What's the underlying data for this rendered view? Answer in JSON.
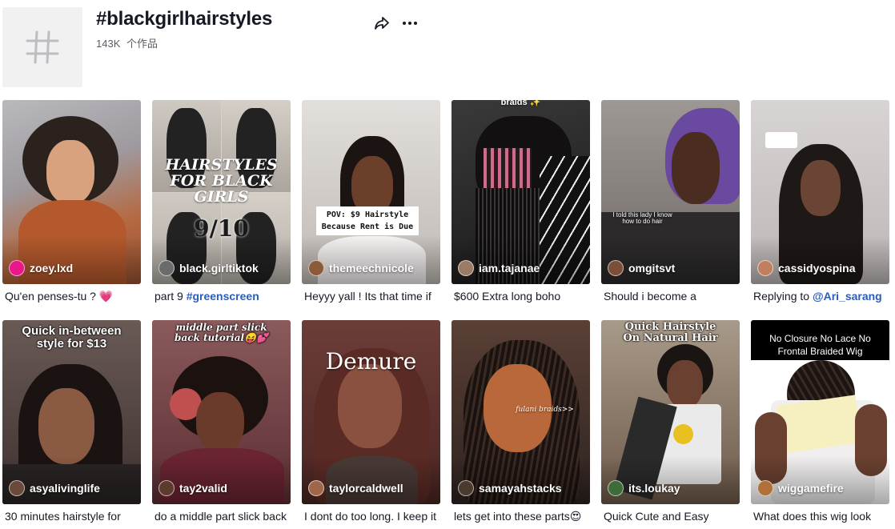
{
  "header": {
    "title": "#blackgirlhairstyles",
    "video_count": "143K",
    "video_unit": "个作品",
    "icons": {
      "tile": "hashtag-icon",
      "share": "share-icon",
      "more": "more-icon"
    }
  },
  "videos": [
    {
      "author": "zoey.lxd",
      "caption": "Qu'en penses-tu ? 💗",
      "tag": "",
      "overlay": "",
      "avatar_color": "#e8178a",
      "bg": "#b56a43"
    },
    {
      "author": "black.girltiktok",
      "caption": "part 9 ",
      "tag": "#greenscreen",
      "overlay": "HAIRSTYLES FOR BLACK GIRLS",
      "overlay2": "9/10",
      "avatar_color": "#6b6b6b",
      "bg": "#d8d2cb"
    },
    {
      "author": "themeechnicole",
      "caption": "Heyyy yall ! Its that time if",
      "tag": "",
      "overlay": "POV: $9 Hairstyle Because Rent is Due",
      "avatar_color": "#8a5a3a",
      "bg": "#c9c5c2"
    },
    {
      "author": "iam.tajanae",
      "caption": "$600 Extra long boho",
      "tag": "",
      "overlay": "braids ✨",
      "avatar_color": "#9a7b66",
      "bg": "#2a2728"
    },
    {
      "author": "omgitsvt",
      "caption": "Should i become a",
      "tag": "",
      "overlay": "I told this lady I know how to do hair",
      "avatar_color": "#7b4e3a",
      "bg": "#6f6a66"
    },
    {
      "author": "cassidyospina",
      "caption": "Replying to ",
      "tag": "@Ari_sarang",
      "overlay": "",
      "avatar_color": "#c08060",
      "bg": "#cfcacb"
    },
    {
      "author": "asyalivinglife",
      "caption": "30 minutes hairstyle for",
      "tag": "",
      "overlay": "Quick in-between style for $13",
      "avatar_color": "#6a4a3a",
      "bg": "#5b4a46"
    },
    {
      "author": "tay2valid",
      "caption": "do a middle part slick back",
      "tag": "",
      "overlay": "middle part slick back tutorial😝💕",
      "avatar_color": "#5d3a2e",
      "bg": "#6b3a3c"
    },
    {
      "author": "taylorcaldwell",
      "caption": "I dont do too long. I keep it",
      "tag": "",
      "overlay": "Demure",
      "avatar_color": "#a0664a",
      "bg": "#7e4b43"
    },
    {
      "author": "samayahstacks",
      "caption": "lets get into these parts😍",
      "tag": "",
      "overlay": "fulani braids>>",
      "avatar_color": "#4b3b2f",
      "bg": "#3f2f28"
    },
    {
      "author": "its.loukay",
      "caption": "Quick Cute and Easy",
      "tag": "",
      "overlay": "Quick Hairstyle On Natural Hair",
      "avatar_color": "#3f6b3a",
      "bg": "#8f7a69"
    },
    {
      "author": "wiggamefire",
      "caption": "What does this wig look",
      "tag": "",
      "overlay": "No Closure No Lace No Frontal Braided Wig",
      "avatar_color": "#b0703a",
      "bg": "#e6e2df"
    }
  ]
}
